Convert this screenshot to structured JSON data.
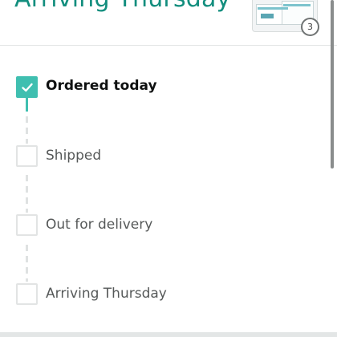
{
  "header": {
    "title": "Arriving Thursday",
    "item_quantity": "3"
  },
  "steps": [
    {
      "label": "Ordered today",
      "completed": true
    },
    {
      "label": "Shipped",
      "completed": false
    },
    {
      "label": "Out for delivery",
      "completed": false
    },
    {
      "label": "Arriving Thursday",
      "completed": false
    }
  ],
  "colors": {
    "accent": "#3fbfb0",
    "title": "#138e7e",
    "text_primary": "#0f1111",
    "text_secondary": "#565959"
  },
  "icons": {
    "check": "check-icon",
    "product": "product-thumbnail"
  }
}
